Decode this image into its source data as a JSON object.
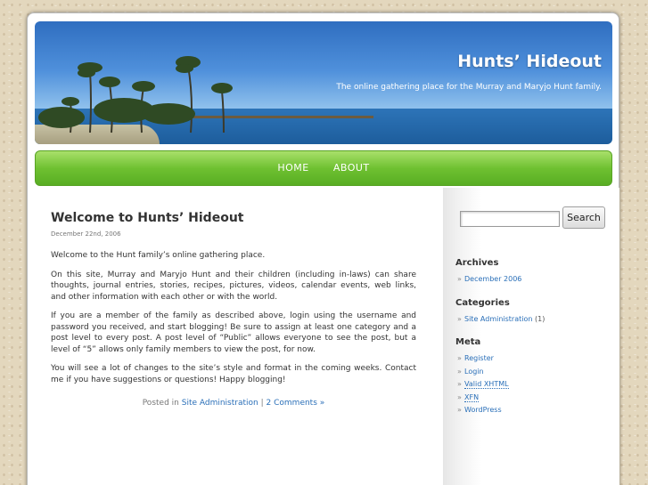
{
  "header": {
    "title": "Hunts’ Hideout",
    "description": "The online gathering place for the Murray and Maryjo Hunt family."
  },
  "nav": {
    "items": [
      {
        "label": "HOME"
      },
      {
        "label": "ABOUT"
      }
    ]
  },
  "post": {
    "title": "Welcome to Hunts’ Hideout",
    "date": "December 22nd, 2006",
    "paragraphs": [
      "Welcome to the Hunt family’s online gathering place.",
      "On this site, Murray and Maryjo Hunt and their children (including in-laws) can share thoughts, journal entries, stories, recipes, pictures, videos, calendar events, web links, and other information with each other or with the world.",
      "If you are a member of the family as described above, login using the username and password you received, and start blogging! Be sure to assign at least one category and a post level to every post. A post level of “Public” allows everyone to see the post, but a level of “5” allows only family members to view the post, for now.",
      "You will see a lot of changes to the site’s style and format in the coming weeks. Contact me if you have suggestions or questions! Happy blogging!"
    ],
    "meta": {
      "posted_in": "Posted in",
      "category": "Site Administration",
      "separator": "|",
      "comments": "2 Comments »"
    }
  },
  "sidebar": {
    "search": {
      "button_label": "Search",
      "value": ""
    },
    "archives": {
      "heading": "Archives",
      "items": [
        "December 2006"
      ]
    },
    "categories": {
      "heading": "Categories",
      "items": [
        {
          "label": "Site Administration",
          "count": "(1)"
        }
      ]
    },
    "meta": {
      "heading": "Meta",
      "items": [
        "Register",
        "Login",
        "Valid XHTML",
        "XFN",
        "WordPress"
      ]
    }
  }
}
